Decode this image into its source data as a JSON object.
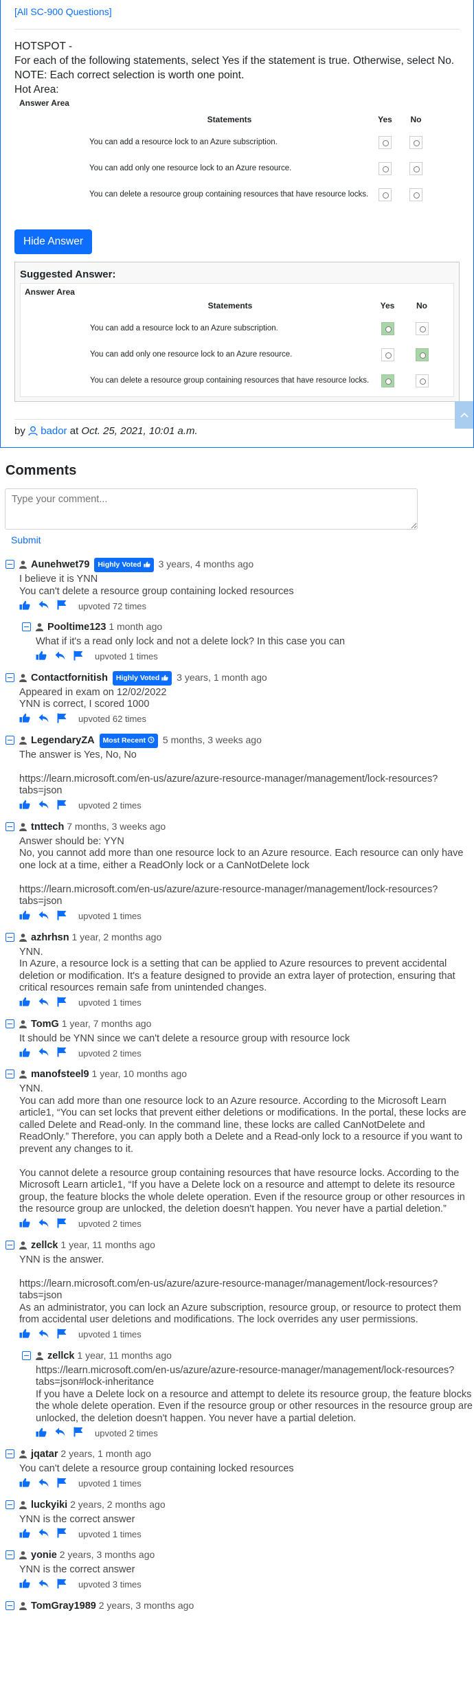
{
  "question": {
    "all_link": "[All SC-900 Questions]",
    "lines": [
      "HOTSPOT -",
      "For each of the following statements, select Yes if the statement is true. Otherwise, select No.",
      "NOTE: Each correct selection is worth one point.",
      "Hot Area:"
    ],
    "answer_area": "Answer Area",
    "col_statements": "Statements",
    "col_yes": "Yes",
    "col_no": "No",
    "statements": [
      "You can add a resource lock to an Azure subscription.",
      "You can add only one resource lock to an Azure resource.",
      "You can delete a resource group containing resources that have resource locks."
    ],
    "hide_button": "Hide Answer",
    "suggested_title": "Suggested Answer:",
    "suggested_selection": [
      "Yes",
      "No",
      "Yes"
    ],
    "byline_prefix": "by",
    "author": "bador",
    "byline_at": "at",
    "date": "Oct. 25, 2021, 10:01 a.m."
  },
  "comments": {
    "title": "Comments",
    "placeholder": "Type your comment...",
    "submit": "Submit",
    "items": [
      {
        "user": "Aunehwet79",
        "badge": "Highly Voted",
        "date": "3 years, 4 months ago",
        "body": "I believe it is YNN\nYou can't delete a resource group containing locked resources",
        "votes": "upvoted 72 times"
      },
      {
        "user": "Pooltime123",
        "date": "1 month ago",
        "body": "What if it's a read only lock and not a delete lock? In this case you can",
        "votes": "upvoted 1 times"
      },
      {
        "user": "Contactfornitish",
        "badge": "Highly Voted",
        "date": "3 years, 1 month ago",
        "body": "Appeared in exam on 12/02/2022\nYNN is correct, I scored 1000",
        "votes": "upvoted 62 times"
      },
      {
        "user": "LegendaryZA",
        "badge": "Most Recent",
        "date": "5 months, 3 weeks ago",
        "body": "The answer is Yes, No, No\n\nhttps://learn.microsoft.com/en-us/azure/azure-resource-manager/management/lock-resources?tabs=json",
        "votes": "upvoted 2 times"
      },
      {
        "user": "tnttech",
        "date": "7 months, 3 weeks ago",
        "body": "Answer should be: YYN\nNo, you cannot add more than one resource lock to an Azure resource. Each resource can only have one lock at a time, either a ReadOnly lock or a CanNotDelete lock\n\nhttps://learn.microsoft.com/en-us/azure/azure-resource-manager/management/lock-resources?tabs=json",
        "votes": "upvoted 1 times"
      },
      {
        "user": "azhrhsn",
        "date": "1 year, 2 months ago",
        "body": "YNN.\nIn Azure, a resource lock is a setting that can be applied to Azure resources to prevent accidental deletion or modification. It's a feature designed to provide an extra layer of protection, ensuring that critical resources remain safe from unintended changes.",
        "votes": "upvoted 1 times"
      },
      {
        "user": "TomG",
        "date": "1 year, 7 months ago",
        "body": "It should be YNN since we can't delete a resource group with resource lock",
        "votes": "upvoted 2 times"
      },
      {
        "user": "manofsteel9",
        "date": "1 year, 10 months ago",
        "body": "YNN.\nYou can add more than one resource lock to an Azure resource. According to the Microsoft Learn article1, “You can set locks that prevent either deletions or modifications. In the portal, these locks are called Delete and Read-only. In the command line, these locks are called CanNotDelete and ReadOnly.” Therefore, you can apply both a Delete and a Read-only lock to a resource if you want to prevent any changes to it.\n\nYou cannot delete a resource group containing resources that have resource locks. According to the Microsoft Learn article1, “If you have a Delete lock on a resource and attempt to delete its resource group, the feature blocks the whole delete operation. Even if the resource group or other resources in the resource group are unlocked, the deletion doesn't happen. You never have a partial deletion.”",
        "votes": "upvoted 2 times"
      },
      {
        "user": "zellck",
        "date": "1 year, 11 months ago",
        "body": "YNN is the answer.\n\nhttps://learn.microsoft.com/en-us/azure/azure-resource-manager/management/lock-resources?tabs=json\nAs an administrator, you can lock an Azure subscription, resource group, or resource to protect them from accidental user deletions and modifications. The lock overrides any user permissions.",
        "votes": "upvoted 1 times"
      },
      {
        "user": "zellck",
        "date": "1 year, 11 months ago",
        "body": "https://learn.microsoft.com/en-us/azure/azure-resource-manager/management/lock-resources?tabs=json#lock-inheritance\nIf you have a Delete lock on a resource and attempt to delete its resource group, the feature blocks the whole delete operation. Even if the resource group or other resources in the resource group are unlocked, the deletion doesn't happen. You never have a partial deletion.",
        "votes": "upvoted 2 times"
      },
      {
        "user": "jqatar",
        "date": "2 years, 1 month ago",
        "body": "You can't delete a resource group containing locked resources",
        "votes": "upvoted 1 times"
      },
      {
        "user": "luckyiki",
        "date": "2 years, 2 months ago",
        "body": "YNN is the correct answer",
        "votes": "upvoted 1 times"
      },
      {
        "user": "yonie",
        "date": "2 years, 3 months ago",
        "body": "YNN is the correct answer",
        "votes": "upvoted 3 times"
      },
      {
        "user": "TomGray1989",
        "date": "2 years, 3 months ago"
      }
    ]
  }
}
